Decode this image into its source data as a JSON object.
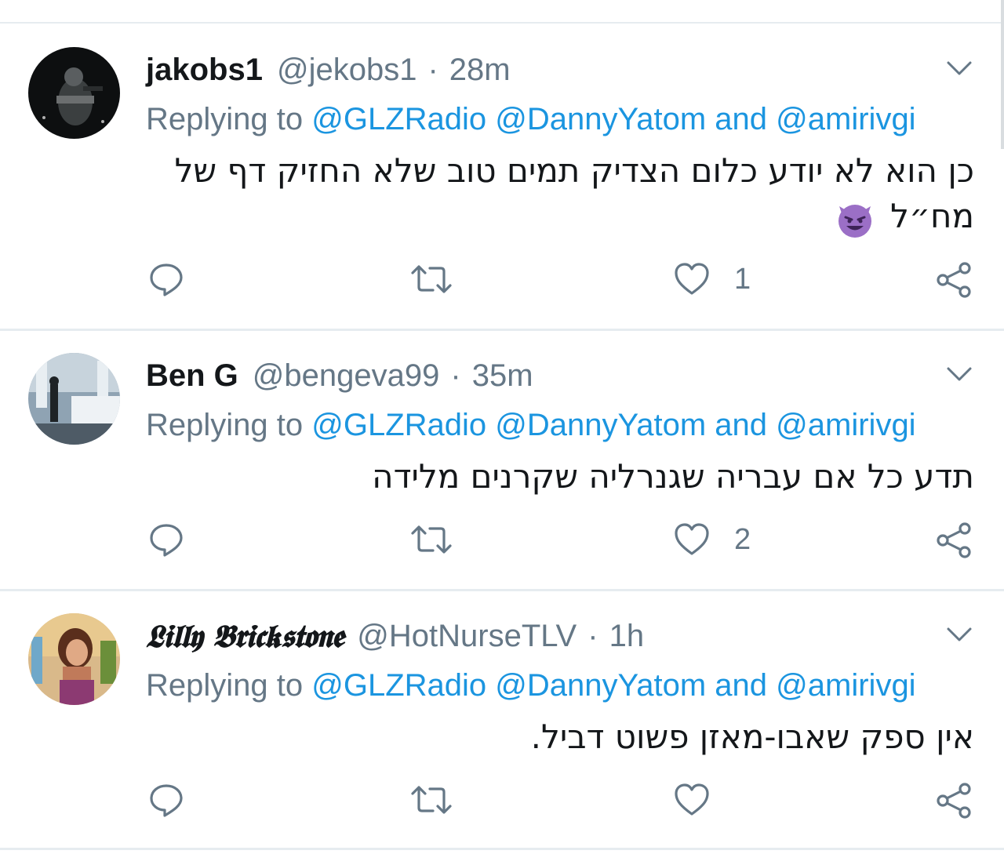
{
  "tweets": [
    {
      "name": "jakobs1",
      "handle": "@jekobs1",
      "separator": "·",
      "time": "28m",
      "replying_prefix": "Replying to",
      "mention_1": "@GLZRadio",
      "mention_2": "@DannyYatom",
      "mention_and": "and",
      "mention_3": "@amirivgi",
      "body_line_1": "כן הוא לא יודע כלום הצדיק תמים טוב שלא החזיק דף של",
      "body_line_2": "מח״ל",
      "like_count": "1",
      "icons": [
        "more-chevron-icon",
        "reply-icon",
        "retweet-icon",
        "heart-icon",
        "share-icon",
        "smiling-devil-emoji"
      ]
    },
    {
      "name": "Ben G",
      "handle": "@bengeva99",
      "separator": "·",
      "time": "35m",
      "replying_prefix": "Replying to",
      "mention_1": "@GLZRadio",
      "mention_2": "@DannyYatom",
      "mention_and": "and",
      "mention_3": "@amirivgi",
      "body_line_1": "תדע כל אם עבריה שגנרליה שקרנים מלידה",
      "like_count": "2",
      "icons": [
        "more-chevron-icon",
        "reply-icon",
        "retweet-icon",
        "heart-icon",
        "share-icon"
      ]
    },
    {
      "name": "𝕷𝖎𝖑𝖑𝖞 𝕭𝖗𝖎𝖈𝖐𝖘𝖙𝖔𝖓𝖊",
      "handle": "@HotNurseTLV",
      "separator": "·",
      "time": "1h",
      "replying_prefix": "Replying to",
      "mention_1": "@GLZRadio",
      "mention_2": "@DannyYatom",
      "mention_and": "and",
      "mention_3": "@amirivgi",
      "body_line_1": "אין ספק שאבו-מאזן פשוט דביל.",
      "like_count": "",
      "icons": [
        "more-chevron-icon",
        "reply-icon",
        "retweet-icon",
        "heart-icon",
        "share-icon"
      ]
    }
  ],
  "colors": {
    "text": "#14171a",
    "secondary": "#657786",
    "link": "#1b95e0",
    "divider": "#e6ecf0",
    "emoji_purple": "#9b6fc6"
  }
}
